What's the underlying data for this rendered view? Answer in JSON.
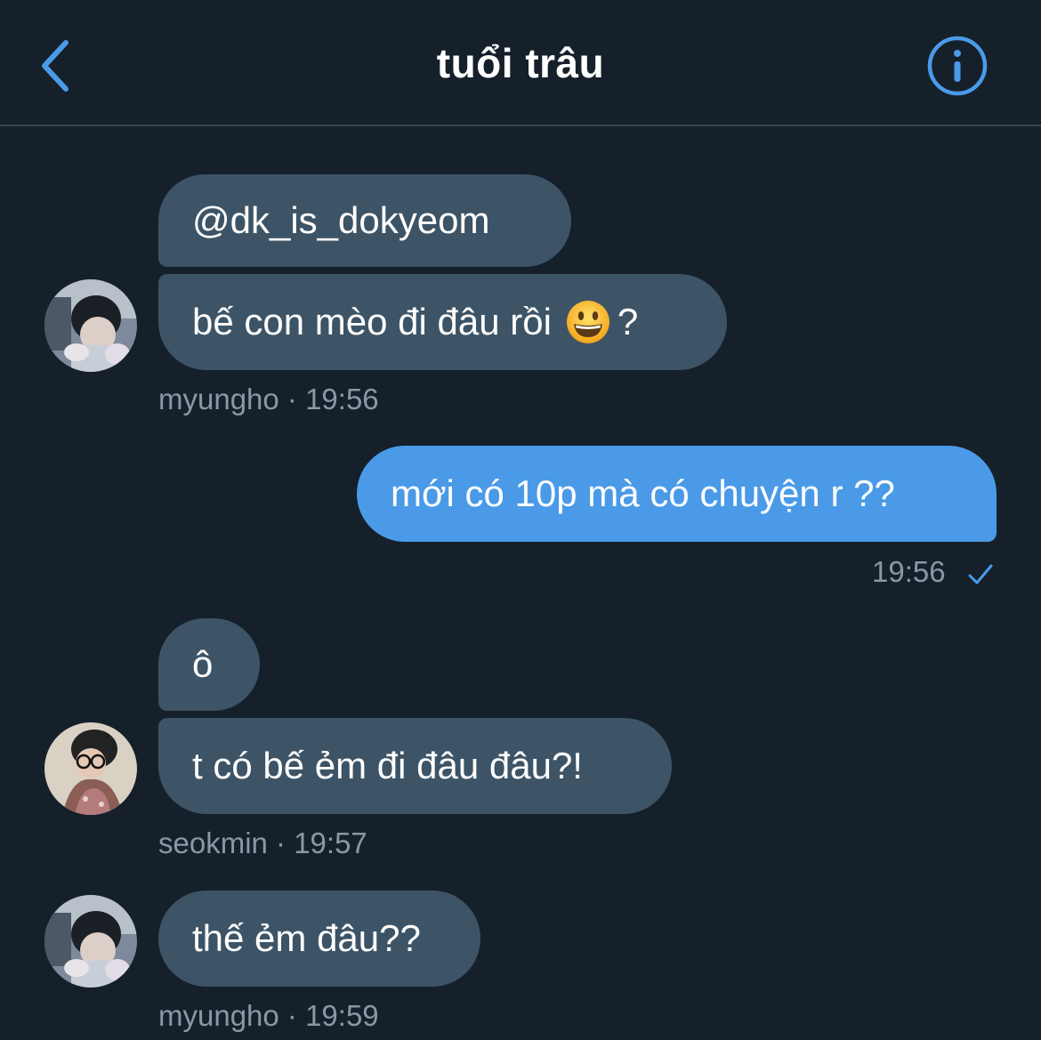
{
  "header": {
    "title": "tuổi trâu",
    "back_icon": "chevron-left-icon",
    "info_icon": "info-icon",
    "accent": "#4a9ae8"
  },
  "colors": {
    "background": "#15202b",
    "incoming_bubble": "#3d5466",
    "outgoing_bubble": "#4a9ae8",
    "meta_text": "#8899a6",
    "divider": "#38444d"
  },
  "messages": [
    {
      "text": "@dk_is_dokyeom",
      "direction": "incoming"
    },
    {
      "text_before_emoji": "bế con mèo đi đâu rồi",
      "emoji": "grinning-face-emoji",
      "text_after_emoji": "?",
      "direction": "incoming"
    },
    {
      "text": "mới có 10p mà có chuyện r ??",
      "direction": "outgoing"
    },
    {
      "text": "ô",
      "direction": "incoming"
    },
    {
      "text": "t có bế ẻm đi đâu đâu?!",
      "direction": "incoming"
    },
    {
      "text": "thế ẻm đâu??",
      "direction": "incoming"
    }
  ],
  "meta": {
    "m1": "myungho · 19:56",
    "m2_time": "19:56",
    "m3": "seokmin · 19:57",
    "m4": "myungho · 19:59"
  },
  "read_icon": "checkmark-icon"
}
